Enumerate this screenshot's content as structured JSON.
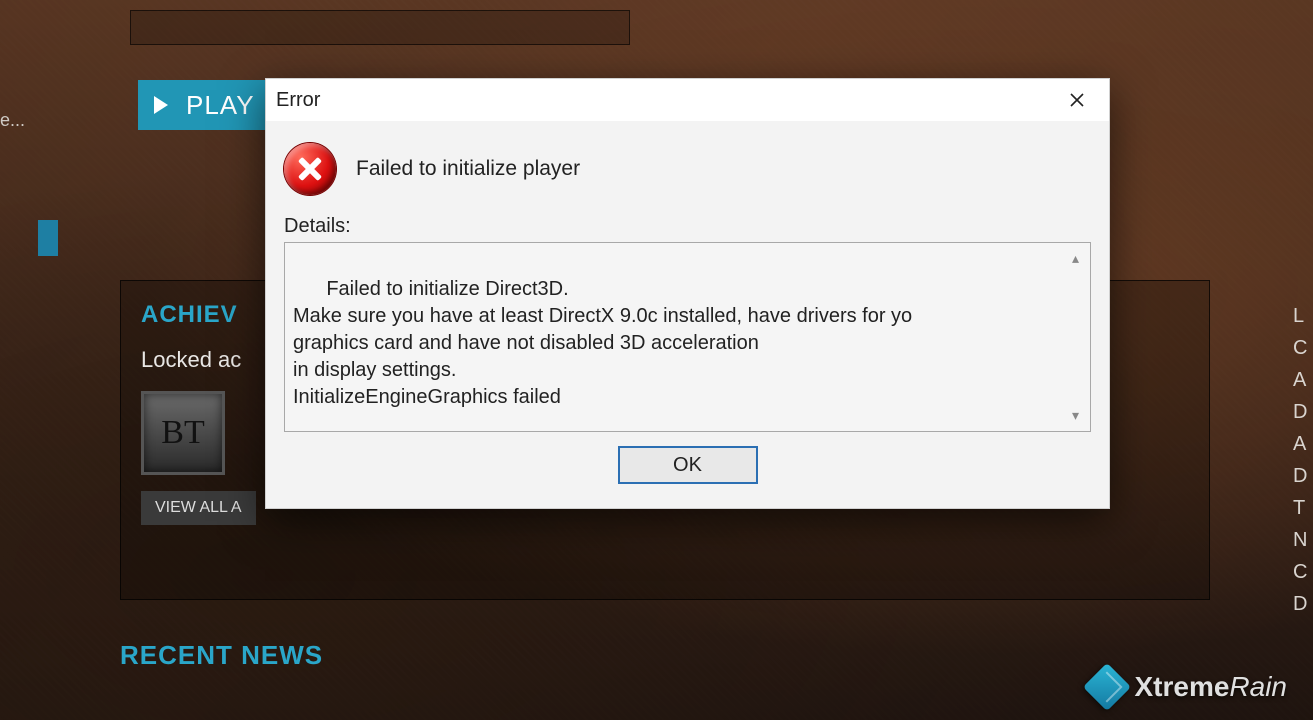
{
  "launcher": {
    "play_label": "PLAY",
    "achievements_heading": "ACHIEV",
    "locked_text": "Locked ac",
    "bt_tile": "BT",
    "view_all": "VIEW ALL A",
    "recent_news": "RECENT NEWS",
    "left_fragment": "e...",
    "right_fragment": "L\nC\nA\nD\nA\nD\nT\nN\nC\nD"
  },
  "dialog": {
    "title": "Error",
    "message": "Failed to initialize player",
    "details_label": "Details:",
    "details_text": "Failed to initialize Direct3D.\nMake sure you have at least DirectX 9.0c installed, have drivers for yo\ngraphics card and have not disabled 3D acceleration\nin display settings.\nInitializeEngineGraphics failed",
    "ok_label": "OK"
  },
  "watermark": {
    "brand_bold": "Xtreme",
    "brand_rest": "Rain"
  }
}
